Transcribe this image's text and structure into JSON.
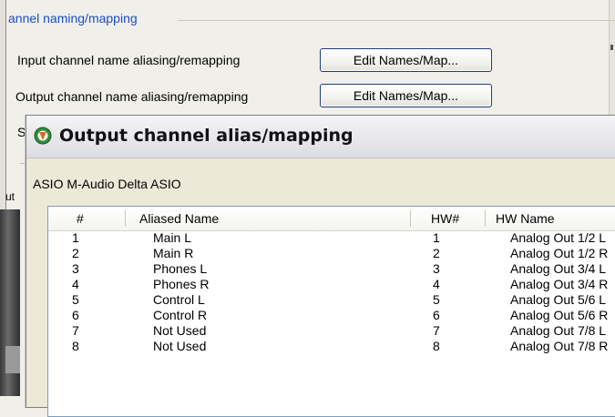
{
  "background": {
    "section_title": "annel naming/mapping",
    "input_row_label": "Input channel name aliasing/remapping",
    "output_row_label": "Output channel name aliasing/remapping",
    "input_button_label": "Edit Names/Map...",
    "output_button_label": "Edit Names/Map...",
    "obscured_label_1": "S",
    "obscured_label_2": "ut"
  },
  "dialog": {
    "title": "Output channel alias/mapping",
    "device_name": "ASIO M-Audio Delta ASIO",
    "columns": [
      "#",
      "Aliased Name",
      "HW#",
      "HW Name"
    ],
    "rows": [
      {
        "num": "1",
        "alias": "Main L",
        "hw": "1",
        "hw_name": "Analog Out 1/2 L"
      },
      {
        "num": "2",
        "alias": "Main R",
        "hw": "2",
        "hw_name": "Analog Out 1/2 R"
      },
      {
        "num": "3",
        "alias": "Phones L",
        "hw": "3",
        "hw_name": "Analog Out 3/4 L"
      },
      {
        "num": "4",
        "alias": "Phones R",
        "hw": "4",
        "hw_name": "Analog Out 3/4 R"
      },
      {
        "num": "5",
        "alias": "Control L",
        "hw": "5",
        "hw_name": "Analog Out 5/6 L"
      },
      {
        "num": "6",
        "alias": "Control R",
        "hw": "6",
        "hw_name": "Analog Out 5/6 R"
      },
      {
        "num": "7",
        "alias": "Not Used",
        "hw": "7",
        "hw_name": "Analog Out 7/8 L"
      },
      {
        "num": "8",
        "alias": "Not Used",
        "hw": "8",
        "hw_name": "Analog Out 7/8 R"
      }
    ]
  },
  "colors": {
    "section_title": "#1a4ec8",
    "button_border": "#1f3d7a",
    "app_icon": "#2f8f3a"
  },
  "icons": {
    "title_icon": "reaper-app-icon"
  }
}
